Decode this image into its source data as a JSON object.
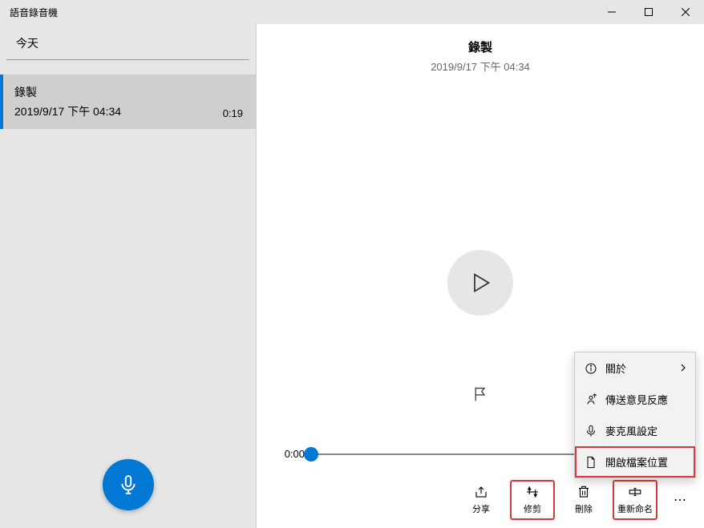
{
  "app": {
    "title": "語音錄音機"
  },
  "sidebar": {
    "date_header": "今天",
    "recordings": [
      {
        "title": "錄製",
        "datetime": "2019/9/17 下午 04:34",
        "duration": "0:19"
      }
    ]
  },
  "content": {
    "title": "錄製",
    "datetime": "2019/9/17 下午 04:34",
    "current_time": "0:00"
  },
  "toolbar": {
    "share": "分享",
    "trim": "修剪",
    "delete": "刪除",
    "rename": "重新命名"
  },
  "menu": {
    "about": "關於",
    "feedback": "傳送意見反應",
    "mic_settings": "麥克風設定",
    "open_location": "開啟檔案位置"
  }
}
